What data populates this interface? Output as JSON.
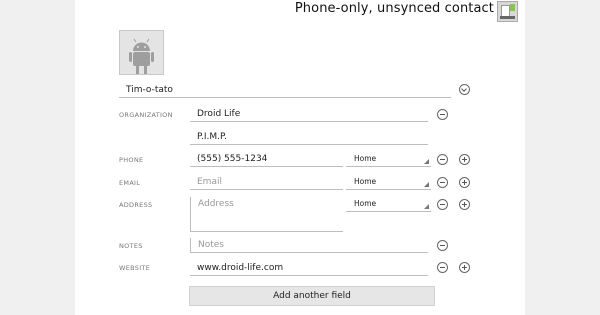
{
  "header": {
    "title": "Phone-only, unsynced contact",
    "account_icon": "phone-contact-icon"
  },
  "name": {
    "value": "Tim-o-tato",
    "expand_icon": "chevron-down-icon"
  },
  "organization": {
    "label": "ORGANIZATION",
    "company": "Droid Life",
    "title": "P.I.M.P."
  },
  "phone": {
    "label": "PHONE",
    "value": "(555) 555-1234",
    "type": "Home"
  },
  "email": {
    "label": "EMAIL",
    "placeholder": "Email",
    "type": "Home"
  },
  "address": {
    "label": "ADDRESS",
    "placeholder": "Address",
    "type": "Home"
  },
  "notes": {
    "label": "NOTES",
    "placeholder": "Notes"
  },
  "website": {
    "label": "WEBSITE",
    "value": "www.droid-life.com"
  },
  "actions": {
    "add_field": "Add another field"
  },
  "icons": {
    "remove": "minus-circle-icon",
    "add": "plus-circle-icon",
    "photo": "android-robot-icon"
  }
}
